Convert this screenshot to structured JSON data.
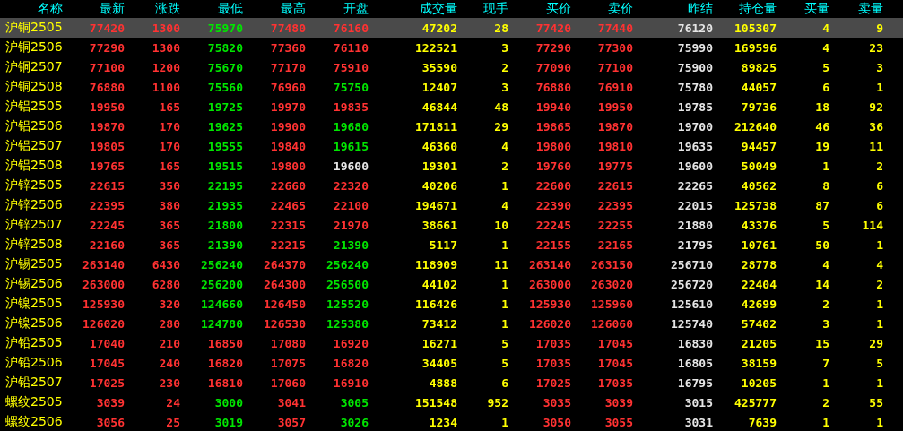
{
  "columns": [
    "名称",
    "最新",
    "涨跌",
    "最低",
    "最高",
    "开盘",
    "成交量",
    "现手",
    "买价",
    "卖价",
    "昨结",
    "持仓量",
    "买量",
    "卖量"
  ],
  "rows": [
    {
      "name": "沪铜2505",
      "selected": true,
      "cells": [
        {
          "text": "77420",
          "color": "#ff3232"
        },
        {
          "text": "1300",
          "color": "#ff3232"
        },
        {
          "text": "75970",
          "color": "#00e600"
        },
        {
          "text": "77480",
          "color": "#ff3232"
        },
        {
          "text": "76160",
          "color": "#ff3232"
        },
        {
          "text": "47202",
          "color": "#ffff00"
        },
        {
          "text": "28",
          "color": "#ffff00"
        },
        {
          "text": "77420",
          "color": "#ff3232"
        },
        {
          "text": "77440",
          "color": "#ff3232"
        },
        {
          "text": "76120",
          "color": "#e6e6e6"
        },
        {
          "text": "105307",
          "color": "#ffff00"
        },
        {
          "text": "4",
          "color": "#ffff00"
        },
        {
          "text": "9",
          "color": "#ffff00"
        }
      ]
    },
    {
      "name": "沪铜2506",
      "selected": false,
      "cells": [
        {
          "text": "77290",
          "color": "#ff3232"
        },
        {
          "text": "1300",
          "color": "#ff3232"
        },
        {
          "text": "75820",
          "color": "#00e600"
        },
        {
          "text": "77360",
          "color": "#ff3232"
        },
        {
          "text": "76110",
          "color": "#ff3232"
        },
        {
          "text": "122521",
          "color": "#ffff00"
        },
        {
          "text": "3",
          "color": "#ffff00"
        },
        {
          "text": "77290",
          "color": "#ff3232"
        },
        {
          "text": "77300",
          "color": "#ff3232"
        },
        {
          "text": "75990",
          "color": "#e6e6e6"
        },
        {
          "text": "169596",
          "color": "#ffff00"
        },
        {
          "text": "4",
          "color": "#ffff00"
        },
        {
          "text": "23",
          "color": "#ffff00"
        }
      ]
    },
    {
      "name": "沪铜2507",
      "selected": false,
      "cells": [
        {
          "text": "77100",
          "color": "#ff3232"
        },
        {
          "text": "1200",
          "color": "#ff3232"
        },
        {
          "text": "75670",
          "color": "#00e600"
        },
        {
          "text": "77170",
          "color": "#ff3232"
        },
        {
          "text": "75910",
          "color": "#ff3232"
        },
        {
          "text": "35590",
          "color": "#ffff00"
        },
        {
          "text": "2",
          "color": "#ffff00"
        },
        {
          "text": "77090",
          "color": "#ff3232"
        },
        {
          "text": "77100",
          "color": "#ff3232"
        },
        {
          "text": "75900",
          "color": "#e6e6e6"
        },
        {
          "text": "89825",
          "color": "#ffff00"
        },
        {
          "text": "5",
          "color": "#ffff00"
        },
        {
          "text": "3",
          "color": "#ffff00"
        }
      ]
    },
    {
      "name": "沪铜2508",
      "selected": false,
      "cells": [
        {
          "text": "76880",
          "color": "#ff3232"
        },
        {
          "text": "1100",
          "color": "#ff3232"
        },
        {
          "text": "75560",
          "color": "#00e600"
        },
        {
          "text": "76960",
          "color": "#ff3232"
        },
        {
          "text": "75750",
          "color": "#00e600"
        },
        {
          "text": "12407",
          "color": "#ffff00"
        },
        {
          "text": "3",
          "color": "#ffff00"
        },
        {
          "text": "76880",
          "color": "#ff3232"
        },
        {
          "text": "76910",
          "color": "#ff3232"
        },
        {
          "text": "75780",
          "color": "#e6e6e6"
        },
        {
          "text": "44057",
          "color": "#ffff00"
        },
        {
          "text": "6",
          "color": "#ffff00"
        },
        {
          "text": "1",
          "color": "#ffff00"
        }
      ]
    },
    {
      "name": "沪铝2505",
      "selected": false,
      "cells": [
        {
          "text": "19950",
          "color": "#ff3232"
        },
        {
          "text": "165",
          "color": "#ff3232"
        },
        {
          "text": "19725",
          "color": "#00e600"
        },
        {
          "text": "19970",
          "color": "#ff3232"
        },
        {
          "text": "19835",
          "color": "#ff3232"
        },
        {
          "text": "46844",
          "color": "#ffff00"
        },
        {
          "text": "48",
          "color": "#ffff00"
        },
        {
          "text": "19940",
          "color": "#ff3232"
        },
        {
          "text": "19950",
          "color": "#ff3232"
        },
        {
          "text": "19785",
          "color": "#e6e6e6"
        },
        {
          "text": "79736",
          "color": "#ffff00"
        },
        {
          "text": "18",
          "color": "#ffff00"
        },
        {
          "text": "92",
          "color": "#ffff00"
        }
      ]
    },
    {
      "name": "沪铝2506",
      "selected": false,
      "cells": [
        {
          "text": "19870",
          "color": "#ff3232"
        },
        {
          "text": "170",
          "color": "#ff3232"
        },
        {
          "text": "19625",
          "color": "#00e600"
        },
        {
          "text": "19900",
          "color": "#ff3232"
        },
        {
          "text": "19680",
          "color": "#00e600"
        },
        {
          "text": "171811",
          "color": "#ffff00"
        },
        {
          "text": "29",
          "color": "#ffff00"
        },
        {
          "text": "19865",
          "color": "#ff3232"
        },
        {
          "text": "19870",
          "color": "#ff3232"
        },
        {
          "text": "19700",
          "color": "#e6e6e6"
        },
        {
          "text": "212640",
          "color": "#ffff00"
        },
        {
          "text": "46",
          "color": "#ffff00"
        },
        {
          "text": "36",
          "color": "#ffff00"
        }
      ]
    },
    {
      "name": "沪铝2507",
      "selected": false,
      "cells": [
        {
          "text": "19805",
          "color": "#ff3232"
        },
        {
          "text": "170",
          "color": "#ff3232"
        },
        {
          "text": "19555",
          "color": "#00e600"
        },
        {
          "text": "19840",
          "color": "#ff3232"
        },
        {
          "text": "19615",
          "color": "#00e600"
        },
        {
          "text": "46360",
          "color": "#ffff00"
        },
        {
          "text": "4",
          "color": "#ffff00"
        },
        {
          "text": "19800",
          "color": "#ff3232"
        },
        {
          "text": "19810",
          "color": "#ff3232"
        },
        {
          "text": "19635",
          "color": "#e6e6e6"
        },
        {
          "text": "94457",
          "color": "#ffff00"
        },
        {
          "text": "19",
          "color": "#ffff00"
        },
        {
          "text": "11",
          "color": "#ffff00"
        }
      ]
    },
    {
      "name": "沪铝2508",
      "selected": false,
      "cells": [
        {
          "text": "19765",
          "color": "#ff3232"
        },
        {
          "text": "165",
          "color": "#ff3232"
        },
        {
          "text": "19515",
          "color": "#00e600"
        },
        {
          "text": "19800",
          "color": "#ff3232"
        },
        {
          "text": "19600",
          "color": "#e6e6e6"
        },
        {
          "text": "19301",
          "color": "#ffff00"
        },
        {
          "text": "2",
          "color": "#ffff00"
        },
        {
          "text": "19760",
          "color": "#ff3232"
        },
        {
          "text": "19775",
          "color": "#ff3232"
        },
        {
          "text": "19600",
          "color": "#e6e6e6"
        },
        {
          "text": "50049",
          "color": "#ffff00"
        },
        {
          "text": "1",
          "color": "#ffff00"
        },
        {
          "text": "2",
          "color": "#ffff00"
        }
      ]
    },
    {
      "name": "沪锌2505",
      "selected": false,
      "cells": [
        {
          "text": "22615",
          "color": "#ff3232"
        },
        {
          "text": "350",
          "color": "#ff3232"
        },
        {
          "text": "22195",
          "color": "#00e600"
        },
        {
          "text": "22660",
          "color": "#ff3232"
        },
        {
          "text": "22320",
          "color": "#ff3232"
        },
        {
          "text": "40206",
          "color": "#ffff00"
        },
        {
          "text": "1",
          "color": "#ffff00"
        },
        {
          "text": "22600",
          "color": "#ff3232"
        },
        {
          "text": "22615",
          "color": "#ff3232"
        },
        {
          "text": "22265",
          "color": "#e6e6e6"
        },
        {
          "text": "40562",
          "color": "#ffff00"
        },
        {
          "text": "8",
          "color": "#ffff00"
        },
        {
          "text": "6",
          "color": "#ffff00"
        }
      ]
    },
    {
      "name": "沪锌2506",
      "selected": false,
      "cells": [
        {
          "text": "22395",
          "color": "#ff3232"
        },
        {
          "text": "380",
          "color": "#ff3232"
        },
        {
          "text": "21935",
          "color": "#00e600"
        },
        {
          "text": "22465",
          "color": "#ff3232"
        },
        {
          "text": "22100",
          "color": "#ff3232"
        },
        {
          "text": "194671",
          "color": "#ffff00"
        },
        {
          "text": "4",
          "color": "#ffff00"
        },
        {
          "text": "22390",
          "color": "#ff3232"
        },
        {
          "text": "22395",
          "color": "#ff3232"
        },
        {
          "text": "22015",
          "color": "#e6e6e6"
        },
        {
          "text": "125738",
          "color": "#ffff00"
        },
        {
          "text": "87",
          "color": "#ffff00"
        },
        {
          "text": "6",
          "color": "#ffff00"
        }
      ]
    },
    {
      "name": "沪锌2507",
      "selected": false,
      "cells": [
        {
          "text": "22245",
          "color": "#ff3232"
        },
        {
          "text": "365",
          "color": "#ff3232"
        },
        {
          "text": "21800",
          "color": "#00e600"
        },
        {
          "text": "22315",
          "color": "#ff3232"
        },
        {
          "text": "21970",
          "color": "#ff3232"
        },
        {
          "text": "38661",
          "color": "#ffff00"
        },
        {
          "text": "10",
          "color": "#ffff00"
        },
        {
          "text": "22245",
          "color": "#ff3232"
        },
        {
          "text": "22255",
          "color": "#ff3232"
        },
        {
          "text": "21880",
          "color": "#e6e6e6"
        },
        {
          "text": "43376",
          "color": "#ffff00"
        },
        {
          "text": "5",
          "color": "#ffff00"
        },
        {
          "text": "114",
          "color": "#ffff00"
        }
      ]
    },
    {
      "name": "沪锌2508",
      "selected": false,
      "cells": [
        {
          "text": "22160",
          "color": "#ff3232"
        },
        {
          "text": "365",
          "color": "#ff3232"
        },
        {
          "text": "21390",
          "color": "#00e600"
        },
        {
          "text": "22215",
          "color": "#ff3232"
        },
        {
          "text": "21390",
          "color": "#00e600"
        },
        {
          "text": "5117",
          "color": "#ffff00"
        },
        {
          "text": "1",
          "color": "#ffff00"
        },
        {
          "text": "22155",
          "color": "#ff3232"
        },
        {
          "text": "22165",
          "color": "#ff3232"
        },
        {
          "text": "21795",
          "color": "#e6e6e6"
        },
        {
          "text": "10761",
          "color": "#ffff00"
        },
        {
          "text": "50",
          "color": "#ffff00"
        },
        {
          "text": "1",
          "color": "#ffff00"
        }
      ]
    },
    {
      "name": "沪锡2505",
      "selected": false,
      "cells": [
        {
          "text": "263140",
          "color": "#ff3232"
        },
        {
          "text": "6430",
          "color": "#ff3232"
        },
        {
          "text": "256240",
          "color": "#00e600"
        },
        {
          "text": "264370",
          "color": "#ff3232"
        },
        {
          "text": "256240",
          "color": "#00e600"
        },
        {
          "text": "118909",
          "color": "#ffff00"
        },
        {
          "text": "11",
          "color": "#ffff00"
        },
        {
          "text": "263140",
          "color": "#ff3232"
        },
        {
          "text": "263150",
          "color": "#ff3232"
        },
        {
          "text": "256710",
          "color": "#e6e6e6"
        },
        {
          "text": "28778",
          "color": "#ffff00"
        },
        {
          "text": "4",
          "color": "#ffff00"
        },
        {
          "text": "4",
          "color": "#ffff00"
        }
      ]
    },
    {
      "name": "沪锡2506",
      "selected": false,
      "cells": [
        {
          "text": "263000",
          "color": "#ff3232"
        },
        {
          "text": "6280",
          "color": "#ff3232"
        },
        {
          "text": "256200",
          "color": "#00e600"
        },
        {
          "text": "264300",
          "color": "#ff3232"
        },
        {
          "text": "256500",
          "color": "#00e600"
        },
        {
          "text": "44102",
          "color": "#ffff00"
        },
        {
          "text": "1",
          "color": "#ffff00"
        },
        {
          "text": "263000",
          "color": "#ff3232"
        },
        {
          "text": "263020",
          "color": "#ff3232"
        },
        {
          "text": "256720",
          "color": "#e6e6e6"
        },
        {
          "text": "22404",
          "color": "#ffff00"
        },
        {
          "text": "14",
          "color": "#ffff00"
        },
        {
          "text": "2",
          "color": "#ffff00"
        }
      ]
    },
    {
      "name": "沪镍2505",
      "selected": false,
      "cells": [
        {
          "text": "125930",
          "color": "#ff3232"
        },
        {
          "text": "320",
          "color": "#ff3232"
        },
        {
          "text": "124660",
          "color": "#00e600"
        },
        {
          "text": "126450",
          "color": "#ff3232"
        },
        {
          "text": "125520",
          "color": "#00e600"
        },
        {
          "text": "116426",
          "color": "#ffff00"
        },
        {
          "text": "1",
          "color": "#ffff00"
        },
        {
          "text": "125930",
          "color": "#ff3232"
        },
        {
          "text": "125960",
          "color": "#ff3232"
        },
        {
          "text": "125610",
          "color": "#e6e6e6"
        },
        {
          "text": "42699",
          "color": "#ffff00"
        },
        {
          "text": "2",
          "color": "#ffff00"
        },
        {
          "text": "1",
          "color": "#ffff00"
        }
      ]
    },
    {
      "name": "沪镍2506",
      "selected": false,
      "cells": [
        {
          "text": "126020",
          "color": "#ff3232"
        },
        {
          "text": "280",
          "color": "#ff3232"
        },
        {
          "text": "124780",
          "color": "#00e600"
        },
        {
          "text": "126530",
          "color": "#ff3232"
        },
        {
          "text": "125380",
          "color": "#00e600"
        },
        {
          "text": "73412",
          "color": "#ffff00"
        },
        {
          "text": "1",
          "color": "#ffff00"
        },
        {
          "text": "126020",
          "color": "#ff3232"
        },
        {
          "text": "126060",
          "color": "#ff3232"
        },
        {
          "text": "125740",
          "color": "#e6e6e6"
        },
        {
          "text": "57402",
          "color": "#ffff00"
        },
        {
          "text": "3",
          "color": "#ffff00"
        },
        {
          "text": "1",
          "color": "#ffff00"
        }
      ]
    },
    {
      "name": "沪铅2505",
      "selected": false,
      "cells": [
        {
          "text": "17040",
          "color": "#ff3232"
        },
        {
          "text": "210",
          "color": "#ff3232"
        },
        {
          "text": "16850",
          "color": "#ff3232"
        },
        {
          "text": "17080",
          "color": "#ff3232"
        },
        {
          "text": "16920",
          "color": "#ff3232"
        },
        {
          "text": "16271",
          "color": "#ffff00"
        },
        {
          "text": "5",
          "color": "#ffff00"
        },
        {
          "text": "17035",
          "color": "#ff3232"
        },
        {
          "text": "17045",
          "color": "#ff3232"
        },
        {
          "text": "16830",
          "color": "#e6e6e6"
        },
        {
          "text": "21205",
          "color": "#ffff00"
        },
        {
          "text": "15",
          "color": "#ffff00"
        },
        {
          "text": "29",
          "color": "#ffff00"
        }
      ]
    },
    {
      "name": "沪铅2506",
      "selected": false,
      "cells": [
        {
          "text": "17045",
          "color": "#ff3232"
        },
        {
          "text": "240",
          "color": "#ff3232"
        },
        {
          "text": "16820",
          "color": "#ff3232"
        },
        {
          "text": "17075",
          "color": "#ff3232"
        },
        {
          "text": "16820",
          "color": "#ff3232"
        },
        {
          "text": "34405",
          "color": "#ffff00"
        },
        {
          "text": "5",
          "color": "#ffff00"
        },
        {
          "text": "17035",
          "color": "#ff3232"
        },
        {
          "text": "17045",
          "color": "#ff3232"
        },
        {
          "text": "16805",
          "color": "#e6e6e6"
        },
        {
          "text": "38159",
          "color": "#ffff00"
        },
        {
          "text": "7",
          "color": "#ffff00"
        },
        {
          "text": "5",
          "color": "#ffff00"
        }
      ]
    },
    {
      "name": "沪铅2507",
      "selected": false,
      "cells": [
        {
          "text": "17025",
          "color": "#ff3232"
        },
        {
          "text": "230",
          "color": "#ff3232"
        },
        {
          "text": "16810",
          "color": "#ff3232"
        },
        {
          "text": "17060",
          "color": "#ff3232"
        },
        {
          "text": "16910",
          "color": "#ff3232"
        },
        {
          "text": "4888",
          "color": "#ffff00"
        },
        {
          "text": "6",
          "color": "#ffff00"
        },
        {
          "text": "17025",
          "color": "#ff3232"
        },
        {
          "text": "17035",
          "color": "#ff3232"
        },
        {
          "text": "16795",
          "color": "#e6e6e6"
        },
        {
          "text": "10205",
          "color": "#ffff00"
        },
        {
          "text": "1",
          "color": "#ffff00"
        },
        {
          "text": "1",
          "color": "#ffff00"
        }
      ]
    },
    {
      "name": "螺纹2505",
      "selected": false,
      "cells": [
        {
          "text": "3039",
          "color": "#ff3232"
        },
        {
          "text": "24",
          "color": "#ff3232"
        },
        {
          "text": "3000",
          "color": "#00e600"
        },
        {
          "text": "3041",
          "color": "#ff3232"
        },
        {
          "text": "3005",
          "color": "#00e600"
        },
        {
          "text": "151548",
          "color": "#ffff00"
        },
        {
          "text": "952",
          "color": "#ffff00"
        },
        {
          "text": "3035",
          "color": "#ff3232"
        },
        {
          "text": "3039",
          "color": "#ff3232"
        },
        {
          "text": "3015",
          "color": "#e6e6e6"
        },
        {
          "text": "425777",
          "color": "#ffff00"
        },
        {
          "text": "2",
          "color": "#ffff00"
        },
        {
          "text": "55",
          "color": "#ffff00"
        }
      ]
    },
    {
      "name": "螺纹2506",
      "selected": false,
      "cells": [
        {
          "text": "3056",
          "color": "#ff3232"
        },
        {
          "text": "25",
          "color": "#ff3232"
        },
        {
          "text": "3019",
          "color": "#00e600"
        },
        {
          "text": "3057",
          "color": "#ff3232"
        },
        {
          "text": "3026",
          "color": "#00e600"
        },
        {
          "text": "1234",
          "color": "#ffff00"
        },
        {
          "text": "1",
          "color": "#ffff00"
        },
        {
          "text": "3050",
          "color": "#ff3232"
        },
        {
          "text": "3055",
          "color": "#ff3232"
        },
        {
          "text": "3031",
          "color": "#e6e6e6"
        },
        {
          "text": "7639",
          "color": "#ffff00"
        },
        {
          "text": "1",
          "color": "#ffff00"
        },
        {
          "text": "1",
          "color": "#ffff00"
        }
      ]
    }
  ]
}
